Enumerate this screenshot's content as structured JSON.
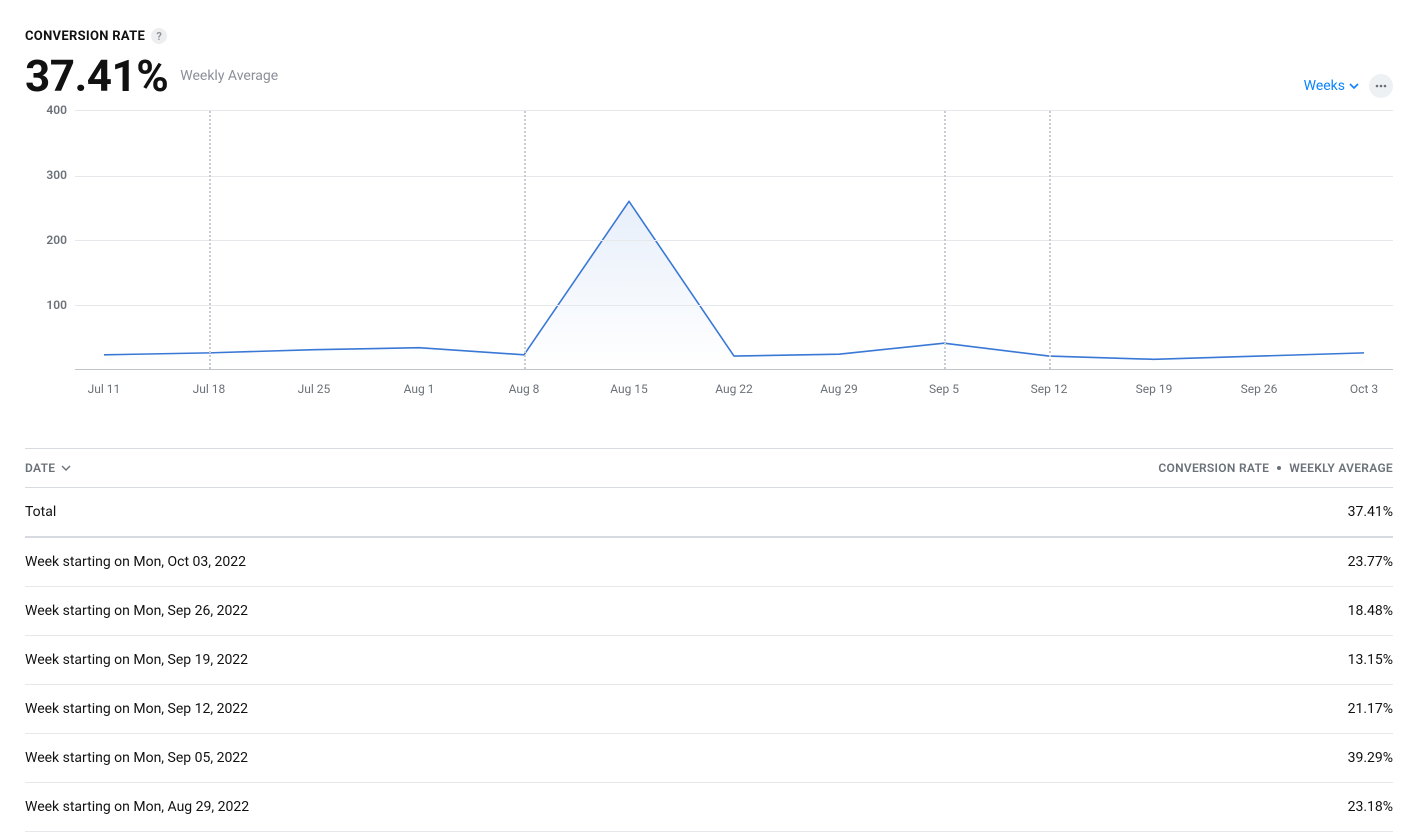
{
  "header": {
    "title": "CONVERSION RATE",
    "help_icon": "?",
    "big_value": "37.41%",
    "subtitle": "Weekly Average",
    "dropdown_label": "Weeks"
  },
  "chart_data": {
    "type": "line",
    "ylabel": "",
    "xlabel": "",
    "ylim": [
      0,
      400
    ],
    "yticks": [
      100,
      200,
      300,
      400
    ],
    "categories": [
      "Jul 11",
      "Jul 18",
      "Jul 25",
      "Aug 1",
      "Aug 8",
      "Aug 15",
      "Aug 22",
      "Aug 29",
      "Sep 5",
      "Sep 12",
      "Sep 19",
      "Sep 26",
      "Oct 3"
    ],
    "values": [
      22,
      25,
      30,
      33,
      22,
      260,
      20,
      23,
      40,
      20,
      15,
      20,
      25
    ],
    "event_markers_x": [
      "Jul 18",
      "Aug 8",
      "Sep 5",
      "Sep 12"
    ]
  },
  "table": {
    "col_date": "DATE",
    "col_metric": "CONVERSION RATE",
    "col_agg": "WEEKLY AVERAGE",
    "total_label": "Total",
    "total_value": "37.41%",
    "rows": [
      {
        "label": "Week starting on Mon, Oct 03, 2022",
        "value": "23.77%"
      },
      {
        "label": "Week starting on Mon, Sep 26, 2022",
        "value": "18.48%"
      },
      {
        "label": "Week starting on Mon, Sep 19, 2022",
        "value": "13.15%"
      },
      {
        "label": "Week starting on Mon, Sep 12, 2022",
        "value": "21.17%"
      },
      {
        "label": "Week starting on Mon, Sep 05, 2022",
        "value": "39.29%"
      },
      {
        "label": "Week starting on Mon, Aug 29, 2022",
        "value": "23.18%"
      }
    ]
  }
}
